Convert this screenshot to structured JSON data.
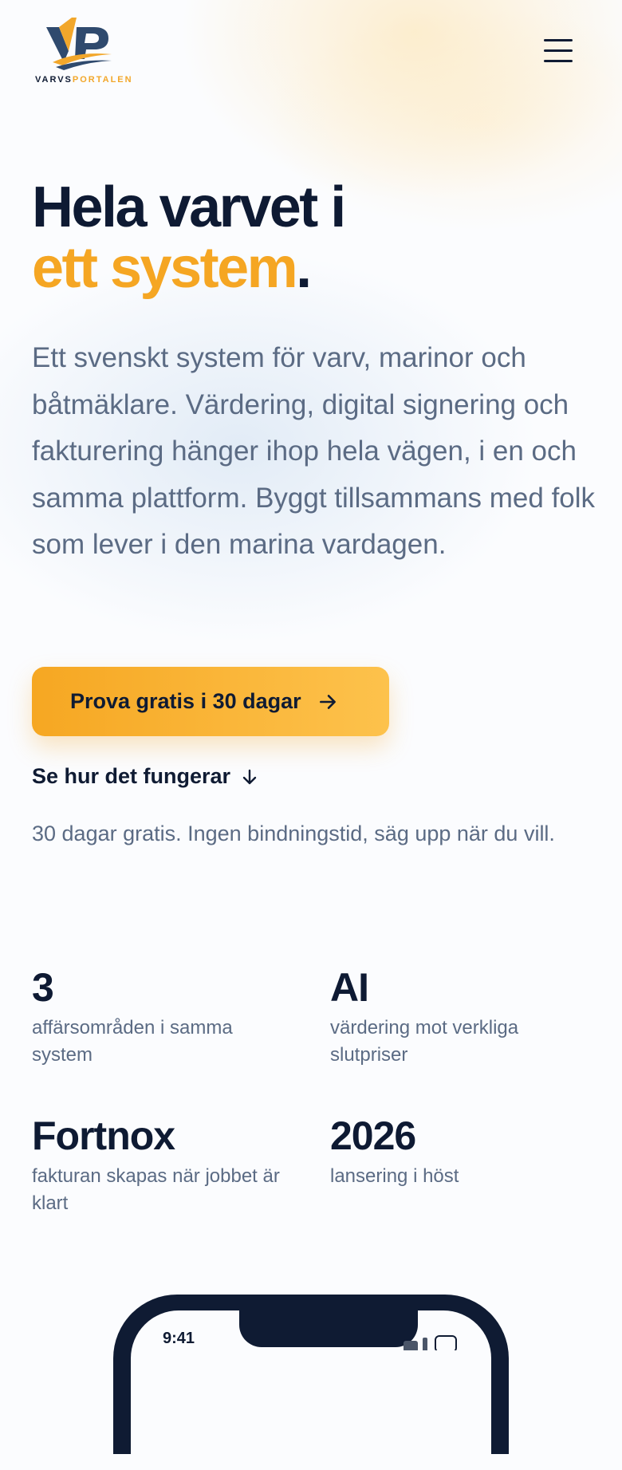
{
  "header": {
    "logo_text_a": "VARVS",
    "logo_text_b": "PORTALEN",
    "menu_icon": "hamburger-menu-icon"
  },
  "hero": {
    "title_line1": "Hela varvet i",
    "title_accent": "ett system",
    "title_period": ".",
    "lead": "Ett svenskt system för varv, marinor och båtmäklare. Värdering, digital signering och fakturering hänger ihop hela vägen, i en och samma plattform. Byggt tillsammans med folk som lever i den marina vardagen.",
    "cta_label": "Prova gratis i 30 dagar",
    "secondary_label": "Se hur det fungerar",
    "note": "30 dagar gratis. Ingen bindningstid, säg upp när du vill."
  },
  "stats": [
    {
      "value": "3",
      "label": "affärsområden i samma system"
    },
    {
      "value": "AI",
      "label": "värdering mot verkliga slutpriser"
    },
    {
      "value": "Fortnox",
      "label": "fakturan skapas när jobbet är klart"
    },
    {
      "value": "2026",
      "label": "lansering i höst"
    }
  ],
  "phone": {
    "time": "9:41"
  },
  "colors": {
    "accent": "#f5a623",
    "navy": "#0e1a33",
    "muted": "#5b6b84"
  }
}
